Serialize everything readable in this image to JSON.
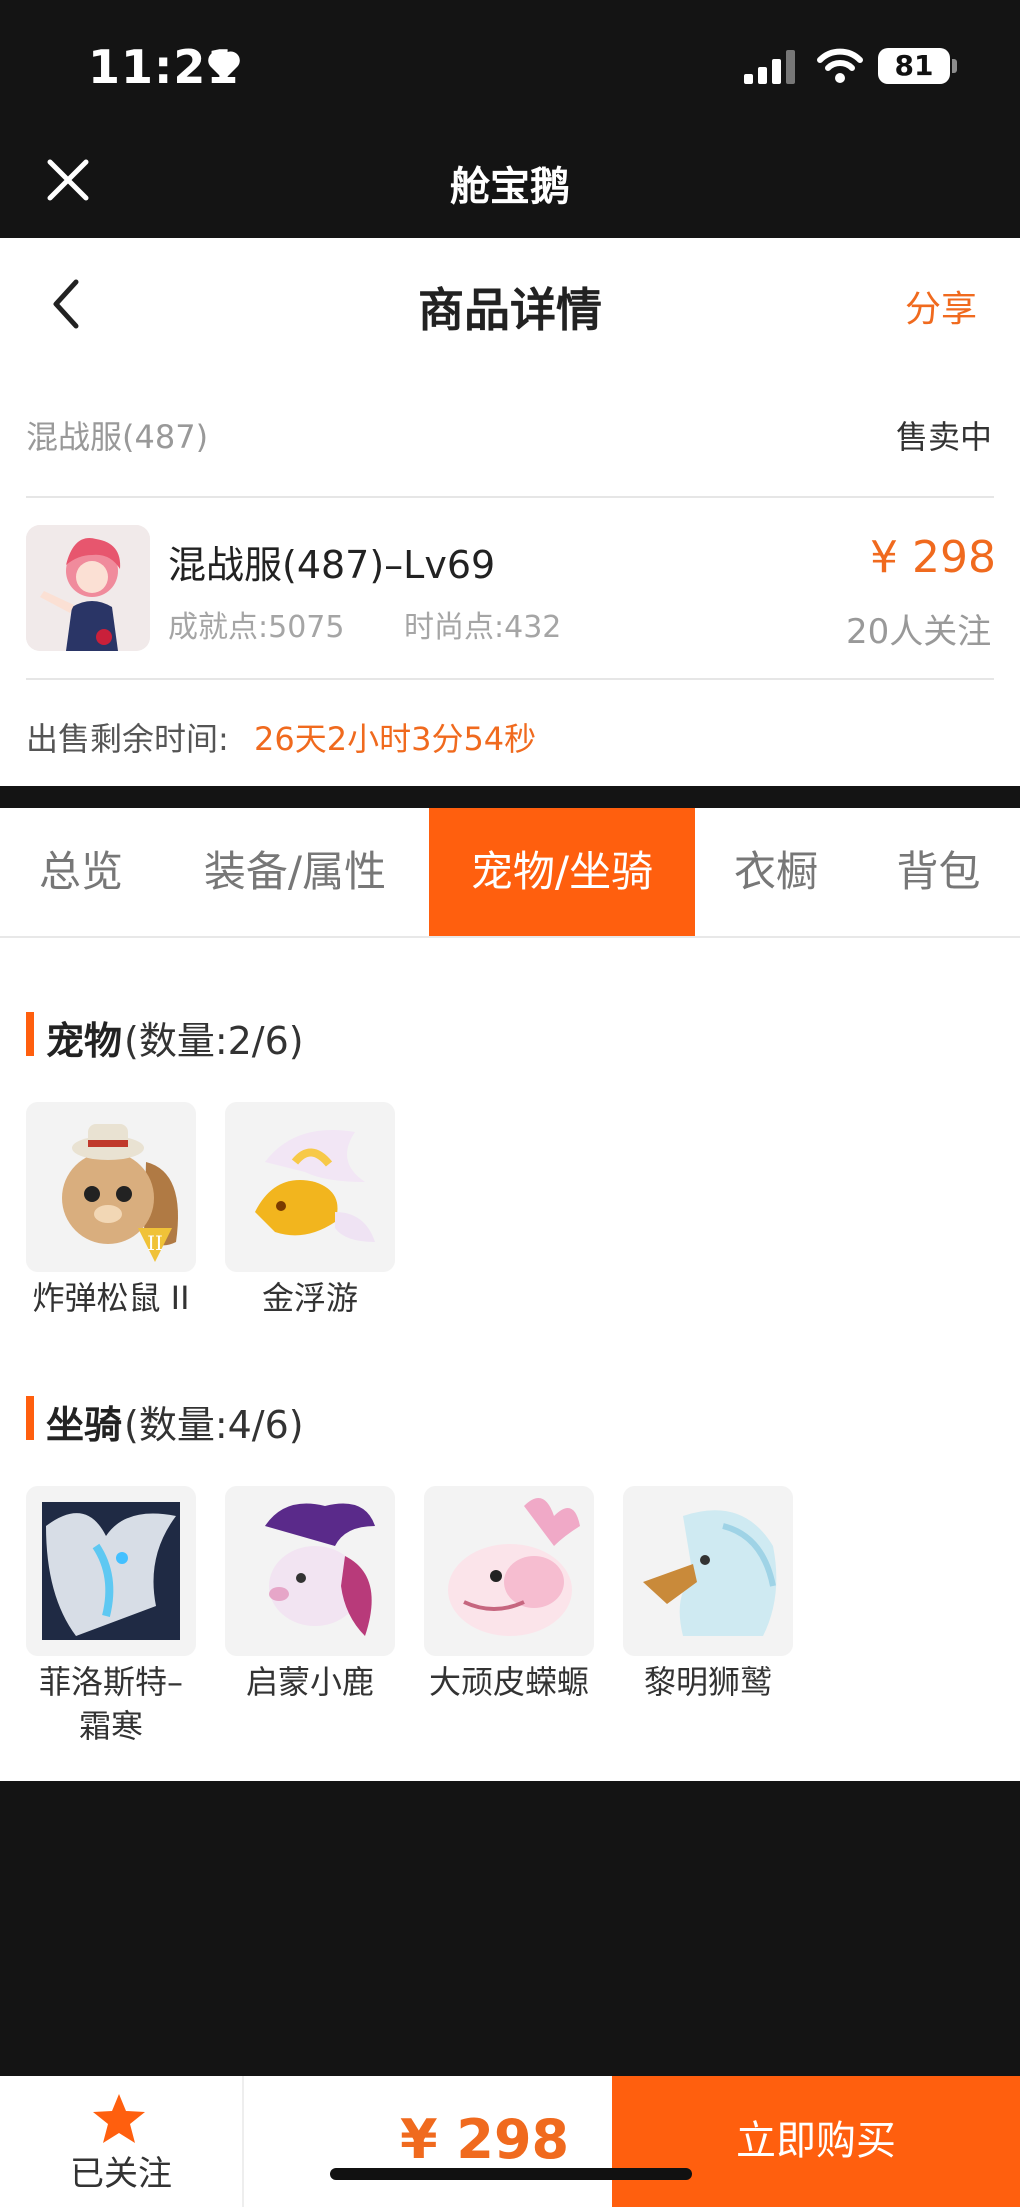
{
  "status_bar": {
    "time": "11:21",
    "battery": "81"
  },
  "app_bar": {
    "title": "舱宝鹅"
  },
  "header": {
    "title": "商品详情",
    "share": "分享"
  },
  "listing": {
    "server": "混战服(487)",
    "status": "售卖中",
    "title": "混战服(487)–Lv69",
    "achievement": "成就点:5075",
    "fashion": "时尚点:432",
    "price": "¥ 298",
    "followers": "20人关注",
    "remaining_label": "出售剩余时间:",
    "remaining_value": "26天2小时3分54秒"
  },
  "tabs": [
    {
      "label": "总览",
      "active": false
    },
    {
      "label": "装备/属性",
      "active": false
    },
    {
      "label": "宠物/坐骑",
      "active": true
    },
    {
      "label": "衣橱",
      "active": false
    },
    {
      "label": "背包",
      "active": false
    }
  ],
  "pets": {
    "title": "宠物",
    "count": "(数量:2/6)",
    "items": [
      {
        "name": "炸弹松鼠 II"
      },
      {
        "name": "金浮游"
      }
    ]
  },
  "mounts": {
    "title": "坐骑",
    "count": "(数量:4/6)",
    "items": [
      {
        "name": "菲洛斯特–\n霜寒"
      },
      {
        "name": "启蒙小鹿"
      },
      {
        "name": "大顽皮蝾螈"
      },
      {
        "name": "黎明狮鹫"
      }
    ]
  },
  "bottom": {
    "follow_label": "已关注",
    "price": "¥ 298",
    "buy": "立即购买"
  },
  "colors": {
    "accent": "#ff5f0e",
    "price": "#f06a1e"
  }
}
